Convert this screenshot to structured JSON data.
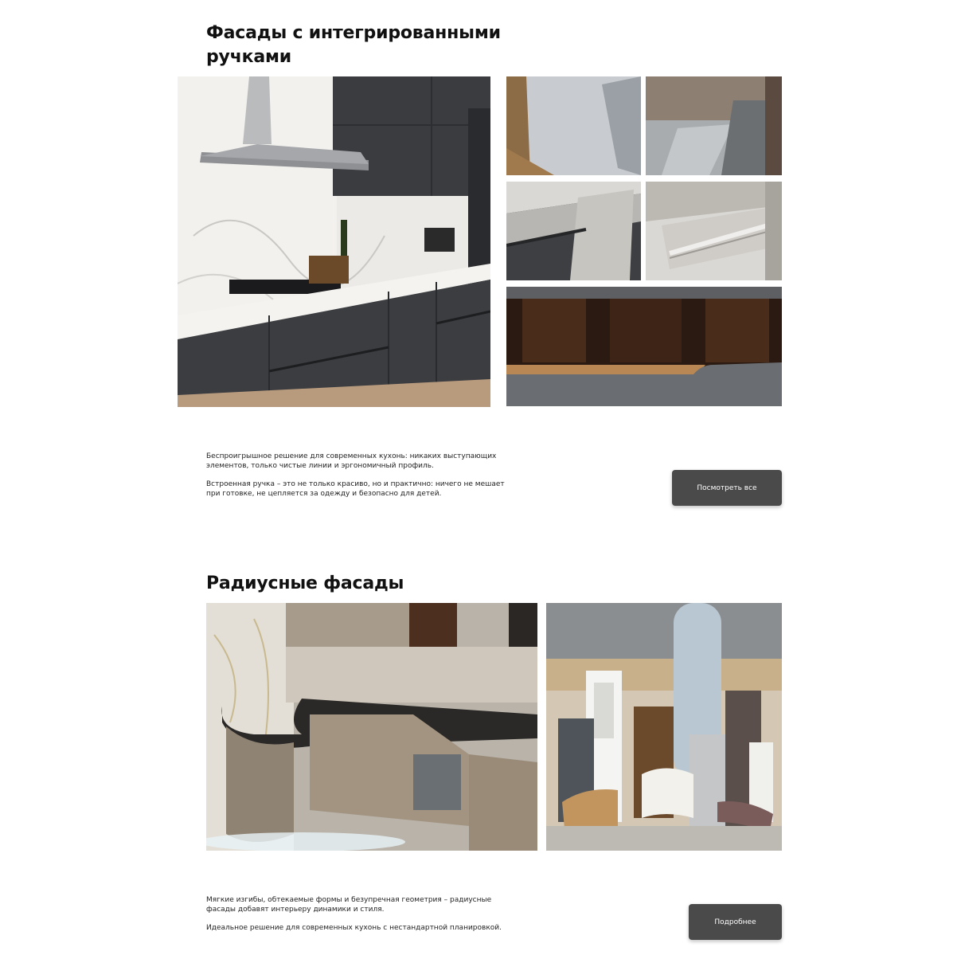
{
  "section1": {
    "title_line1": "Фасады с интегрированными",
    "title_line2": "ручками",
    "paragraph1_line1": "Беспроигрышное решение для современных кухонь: никаких выступающих",
    "paragraph1_line2": "элементов, только чистые линии и эргономичный профиль.",
    "paragraph2_line1": "Встроенная ручка – это не только красиво, но и практично: ничего не мешает",
    "paragraph2_line2": "при готовке, не цепляется за одежду и безопасно для детей.",
    "button_label": "Посмотреть все"
  },
  "section2": {
    "title": "Радиусные фасады",
    "paragraph1_line1": "Мягкие изгибы, обтекаемые формы и безупречная геометрия – радиусные",
    "paragraph1_line2": "фасады добавят интерьеру динамики и стиля.",
    "paragraph2": "Идеальное решение для современных кухонь с нестандартной планировкой.",
    "button_label": "Подробнее"
  },
  "colors": {
    "button_bg": "#4a4a4a",
    "text": "#1a1a1a"
  }
}
